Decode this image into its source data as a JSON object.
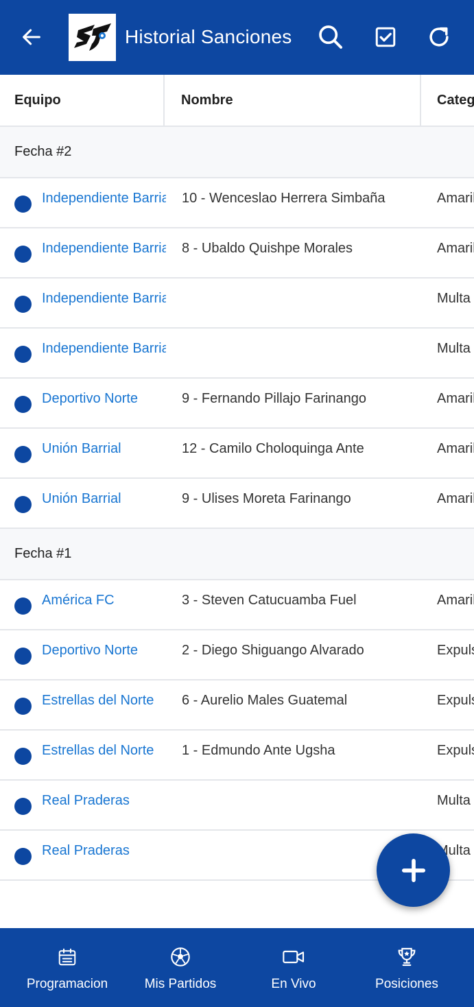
{
  "appbar": {
    "title": "Historial Sanciones",
    "back_icon": "arrow-left-icon",
    "logo_icon": "league-logo",
    "actions": [
      "search-icon",
      "checkbox-icon",
      "refresh-icon"
    ]
  },
  "table": {
    "columns": [
      "Equipo",
      "Nombre",
      "Categ"
    ],
    "groups": [
      {
        "label": "Fecha #2",
        "rows": [
          {
            "team": "Independiente Barrial",
            "name": "10 - Wenceslao Herrera Simbaña",
            "category": "Amarilla"
          },
          {
            "team": "Independiente Barrial",
            "name": "8 - Ubaldo Quishpe Morales",
            "category": "Amarilla"
          },
          {
            "team": "Independiente Barrial",
            "name": "",
            "category": "Multa"
          },
          {
            "team": "Independiente Barrial",
            "name": "",
            "category": "Multa"
          },
          {
            "team": "Deportivo Norte",
            "name": "9 - Fernando Pillajo Farinango",
            "category": "Amarilla"
          },
          {
            "team": "Unión Barrial",
            "name": "12 - Camilo Choloquinga Ante",
            "category": "Amarilla"
          },
          {
            "team": "Unión Barrial",
            "name": "9 - Ulises Moreta Farinango",
            "category": "Amarilla"
          }
        ]
      },
      {
        "label": "Fecha #1",
        "rows": [
          {
            "team": "América FC",
            "name": "3 - Steven Catucuamba Fuel",
            "category": "Amarilla"
          },
          {
            "team": "Deportivo Norte",
            "name": "2 - Diego Shiguango Alvarado",
            "category": "Expulsión"
          },
          {
            "team": "Estrellas del Norte",
            "name": "6 - Aurelio Males Guatemal",
            "category": "Expulsión"
          },
          {
            "team": "Estrellas del Norte",
            "name": "1 - Edmundo Ante Ugsha",
            "category": "Expulsión"
          },
          {
            "team": "Real Praderas",
            "name": "",
            "category": "Multa"
          },
          {
            "team": "Real Praderas",
            "name": "",
            "category": "Multa"
          }
        ]
      }
    ]
  },
  "fab": {
    "icon": "plus-icon"
  },
  "bottom_nav": [
    {
      "label": "Programacion",
      "icon": "calendar-icon"
    },
    {
      "label": "Mis Partidos",
      "icon": "soccer-ball-icon"
    },
    {
      "label": "En Vivo",
      "icon": "video-camera-icon"
    },
    {
      "label": "Posiciones",
      "icon": "trophy-icon"
    }
  ],
  "colors": {
    "primary": "#0d47a1",
    "link": "#1976d2",
    "group_bg": "#f7f8fa",
    "divider": "#e4e6ea"
  }
}
